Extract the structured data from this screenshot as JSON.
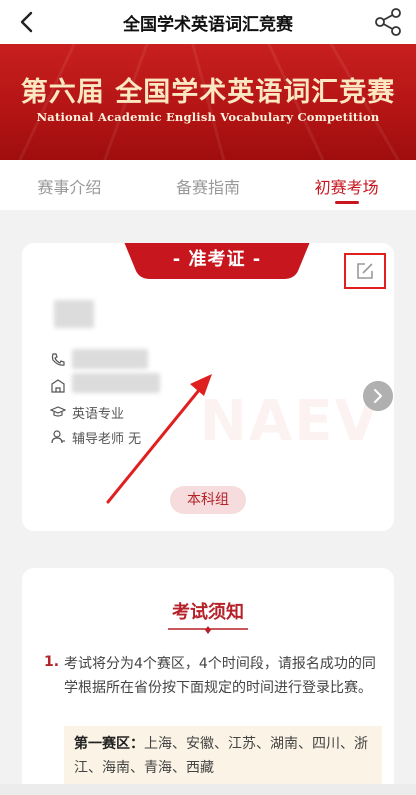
{
  "header": {
    "title": "全国学术英语词汇竞赛"
  },
  "banner": {
    "title": "第六届 全国学术英语词汇竞赛",
    "subtitle": "National Academic English Vocabulary Competition"
  },
  "tabs": [
    {
      "label": "赛事介绍"
    },
    {
      "label": "备赛指南"
    },
    {
      "label": "初赛考场"
    }
  ],
  "ticket": {
    "label": "- 准考证 -",
    "major": "英语专业",
    "advisor": "辅导老师 无",
    "watermark": "NAEV",
    "level": "本科组"
  },
  "notice": {
    "title": "考试须知",
    "item_number": "1.",
    "item_text": "考试将分为4个赛区，4个时间段，请报名成功的同学根据所在省份按下面规定的时间进行登录比赛。",
    "zone_label": "第一赛区：",
    "zone_provinces": "上海、安徽、江苏、湖南、四川、浙江、海南、青海、西藏"
  },
  "colors": {
    "brand_red": "#c7161e",
    "banner_gold": "#fbe7c2",
    "annotation_red": "#e02020"
  }
}
